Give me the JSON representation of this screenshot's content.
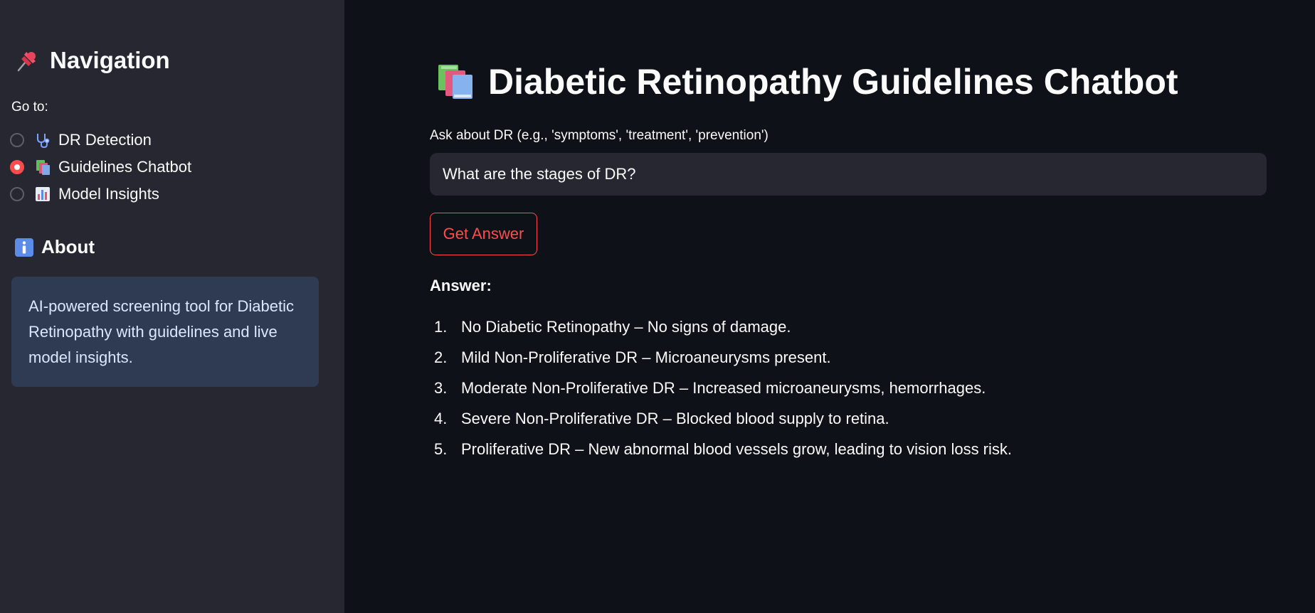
{
  "sidebar": {
    "nav_heading": "Navigation",
    "nav_icon": "pushpin-icon",
    "goto_label": "Go to:",
    "options": [
      {
        "label": "DR Detection",
        "icon": "stethoscope-icon",
        "selected": false
      },
      {
        "label": "Guidelines Chatbot",
        "icon": "books-icon",
        "selected": true
      },
      {
        "label": "Model Insights",
        "icon": "bar-chart-icon",
        "selected": false
      }
    ],
    "about_heading": "About",
    "about_icon": "info-icon",
    "about_text": "AI-powered screening tool for Diabetic Retinopathy with guidelines and live model insights."
  },
  "main": {
    "title": "Diabetic Retinopathy Guidelines Chatbot",
    "title_icon": "books-icon",
    "input_label": "Ask about DR (e.g., 'symptoms', 'treatment', 'prevention')",
    "input_value": "What are the stages of DR?",
    "button_label": "Get Answer",
    "answer_label": "Answer:",
    "answers": [
      {
        "num": "1.",
        "text": "No Diabetic Retinopathy – No signs of damage."
      },
      {
        "num": "2.",
        "text": "Mild Non-Proliferative DR – Microaneurysms present."
      },
      {
        "num": "3.",
        "text": "Moderate Non-Proliferative DR – Increased microaneurysms, hemorrhages."
      },
      {
        "num": "4.",
        "text": "Severe Non-Proliferative DR – Blocked blood supply to retina."
      },
      {
        "num": "5.",
        "text": "Proliferative DR – New abnormal blood vessels grow, leading to vision loss risk."
      }
    ]
  },
  "colors": {
    "background": "#0e1117",
    "sidebar": "#262730",
    "accent": "#ff4b4b",
    "info_box": "#2f3b52"
  }
}
